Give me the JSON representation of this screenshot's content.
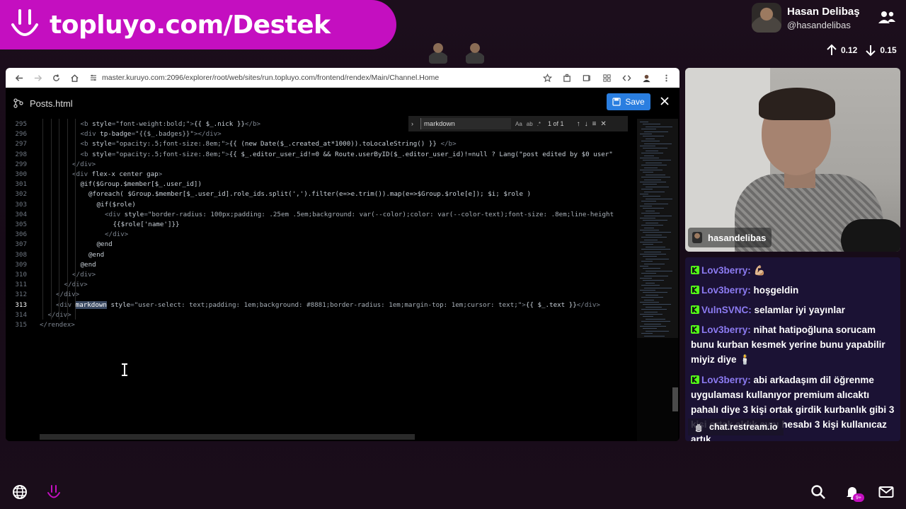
{
  "banner": {
    "text": "topluyo.com/Destek",
    "logo_icon": "smile-logo-icon"
  },
  "profile": {
    "name": "Hasan Delibaş",
    "handle": "@hasandelibas"
  },
  "stats": {
    "up": "0.12",
    "down": "0.15"
  },
  "browser": {
    "url": "master.kuruyo.com:2096/explorer/root/web/sites/run.topluyo.com/frontend/rendex/Main/Channel.Home",
    "file_title": "Posts.html",
    "save_label": "Save",
    "find": {
      "query": "markdown",
      "count": "1 of 1",
      "option_case": "Aa",
      "option_word": "ab",
      "option_regex": ".*"
    },
    "source_label": "hasandelibas"
  },
  "code_lines": [
    {
      "num": "295",
      "indent": 5,
      "parts": [
        [
          "tag",
          "<b "
        ],
        [
          "attr",
          "style"
        ],
        [
          "tag",
          "="
        ],
        [
          "str",
          "\"font-weight:bold;\""
        ],
        [
          "tag",
          ">"
        ],
        [
          "attr",
          "{{ $_.nick }}"
        ],
        [
          "tag",
          "</b>"
        ]
      ]
    },
    {
      "num": "296",
      "indent": 5,
      "parts": [
        [
          "tag",
          "<div "
        ],
        [
          "attr",
          "tp-badge"
        ],
        [
          "tag",
          "="
        ],
        [
          "str",
          "\"{{$_.badges}}\""
        ],
        [
          "tag",
          "></div>"
        ]
      ]
    },
    {
      "num": "297",
      "indent": 5,
      "parts": [
        [
          "tag",
          "<b "
        ],
        [
          "attr",
          "style"
        ],
        [
          "tag",
          "="
        ],
        [
          "str",
          "\"opacity:.5;font-size:.8em;\""
        ],
        [
          "tag",
          ">"
        ],
        [
          "attr",
          "{{ (new Date($_.created_at*1000)).toLocaleString() }}"
        ],
        [
          "tag",
          " </b>"
        ]
      ]
    },
    {
      "num": "298",
      "indent": 5,
      "parts": [
        [
          "tag",
          "<b "
        ],
        [
          "attr",
          "style"
        ],
        [
          "tag",
          "="
        ],
        [
          "str",
          "\"opacity:.5;font-size:.8em;\""
        ],
        [
          "tag",
          ">"
        ],
        [
          "attr",
          "{{ $_.editor_user_id!=0 && Route.userByID($_.editor_user_id)!=null ? Lang(\"post edited by $0 user\""
        ]
      ]
    },
    {
      "num": "299",
      "indent": 4,
      "parts": [
        [
          "tag",
          "</div>"
        ]
      ]
    },
    {
      "num": "300",
      "indent": 4,
      "parts": [
        [
          "tag",
          "<div "
        ],
        [
          "attr",
          "flex-x center gap"
        ],
        [
          "tag",
          ">"
        ]
      ]
    },
    {
      "num": "301",
      "indent": 5,
      "parts": [
        [
          "attr",
          "@if($Group.$member[$_.user_id])"
        ]
      ]
    },
    {
      "num": "302",
      "indent": 6,
      "parts": [
        [
          "attr",
          "@foreach( $Group.$member[$_.user_id].role_ids.split(',').filter(e=>e.trim()).map(e=>$Group.$role[e]); $i; $role )"
        ]
      ]
    },
    {
      "num": "303",
      "indent": 7,
      "parts": [
        [
          "attr",
          "@if($role)"
        ]
      ]
    },
    {
      "num": "304",
      "indent": 8,
      "parts": [
        [
          "tag",
          "<div "
        ],
        [
          "attr",
          "style"
        ],
        [
          "tag",
          "="
        ],
        [
          "str",
          "\"border-radius: 100px;padding: .25em .5em;background: var(--color);color: var(--color-text);font-size: .8em;line-height"
        ]
      ]
    },
    {
      "num": "305",
      "indent": 9,
      "parts": [
        [
          "attr",
          "{{$role['name']}}"
        ]
      ]
    },
    {
      "num": "306",
      "indent": 8,
      "parts": [
        [
          "tag",
          "</div>"
        ]
      ]
    },
    {
      "num": "307",
      "indent": 7,
      "parts": [
        [
          "attr",
          "@end"
        ]
      ]
    },
    {
      "num": "308",
      "indent": 6,
      "parts": [
        [
          "attr",
          "@end"
        ]
      ]
    },
    {
      "num": "309",
      "indent": 5,
      "parts": [
        [
          "attr",
          "@end"
        ]
      ]
    },
    {
      "num": "310",
      "indent": 4,
      "parts": [
        [
          "tag",
          "</div>"
        ]
      ]
    },
    {
      "num": "311",
      "indent": 3,
      "parts": [
        [
          "tag",
          "</div>"
        ]
      ]
    },
    {
      "num": "312",
      "indent": 2,
      "parts": [
        [
          "tag",
          "</div>"
        ]
      ]
    },
    {
      "num": "313",
      "indent": 2,
      "parts": [
        [
          "tag",
          "<div "
        ],
        [
          "hl",
          "markdown"
        ],
        [
          "attr",
          " style"
        ],
        [
          "tag",
          "="
        ],
        [
          "str",
          "\"user-select: text;padding: 1em;background: #8881;border-radius: 1em;margin-top: 1em;cursor: text;\""
        ],
        [
          "tag",
          ">"
        ],
        [
          "attr",
          "{{ $_.text }}"
        ],
        [
          "tag",
          "</div>"
        ]
      ]
    },
    {
      "num": "314",
      "indent": 1,
      "parts": [
        [
          "tag",
          "</div>"
        ]
      ]
    },
    {
      "num": "315",
      "indent": 0,
      "parts": [
        [
          "tag",
          "</rendex>"
        ]
      ]
    }
  ],
  "active_line": "313",
  "webcam": {
    "label": "hasandelibas"
  },
  "chat": {
    "messages": [
      {
        "user": "Lov3berry",
        "text": "💪🏼"
      },
      {
        "user": "Lov3berry",
        "text": "hoşgeldin"
      },
      {
        "user": "VulnSVNC",
        "text": "selamlar iyi yayınlar"
      },
      {
        "user": "Lov3berry",
        "text": "nihat hatipoğluna sorucam bunu kurban kesmek yerine bunu yapabilir miyiz diye 🕯️"
      },
      {
        "user": "Lov3berry",
        "text": "abi arkadaşım dil öğrenme uygulaması kullanıyor premium alıcaktı pahalı diye 3 kişi ortak girdik kurbanlık gibi 3 kişi ortak aldık aynı hesabı 3 kişi kullanıcaz artık"
      }
    ],
    "footer": "chat.restream.io"
  },
  "bottom": {
    "notif_count": "9+"
  },
  "colors": {
    "brand": "#c40fc0",
    "chat_bg": "#1b1234",
    "username": "#8c7bf2",
    "save": "#2a7ee0"
  }
}
